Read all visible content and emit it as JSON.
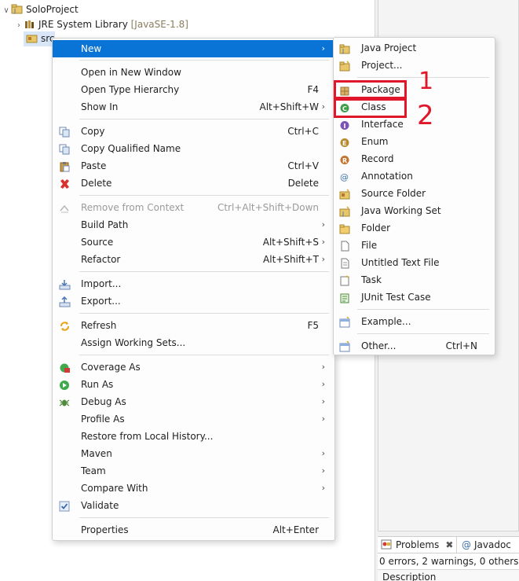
{
  "tree": {
    "project": "SoloProject",
    "jre_label": "JRE System Library",
    "jre_version": "[JavaSE-1.8]",
    "src": "src"
  },
  "context_menu": {
    "items": [
      {
        "label": "New",
        "accel": "",
        "submenu": true,
        "icon": "none",
        "highlighted": true
      },
      {
        "label": "Open in New Window",
        "accel": "",
        "icon": "none"
      },
      {
        "label": "Open Type Hierarchy",
        "accel": "F4",
        "icon": "none"
      },
      {
        "label": "Show In",
        "accel": "Alt+Shift+W",
        "submenu": true,
        "icon": "none"
      },
      {
        "label": "Copy",
        "accel": "Ctrl+C",
        "icon": "copy-icon"
      },
      {
        "label": "Copy Qualified Name",
        "accel": "",
        "icon": "copy-qualified-icon"
      },
      {
        "label": "Paste",
        "accel": "Ctrl+V",
        "icon": "paste-icon"
      },
      {
        "label": "Delete",
        "accel": "Delete",
        "icon": "delete-icon"
      },
      {
        "label": "Remove from Context",
        "accel": "Ctrl+Alt+Shift+Down",
        "icon": "remove-context-icon",
        "disabled": true
      },
      {
        "label": "Build Path",
        "accel": "",
        "submenu": true,
        "icon": "none"
      },
      {
        "label": "Source",
        "accel": "Alt+Shift+S",
        "submenu": true,
        "icon": "none"
      },
      {
        "label": "Refactor",
        "accel": "Alt+Shift+T",
        "submenu": true,
        "icon": "none"
      },
      {
        "label": "Import...",
        "accel": "",
        "icon": "import-icon"
      },
      {
        "label": "Export...",
        "accel": "",
        "icon": "export-icon"
      },
      {
        "label": "Refresh",
        "accel": "F5",
        "icon": "refresh-icon"
      },
      {
        "label": "Assign Working Sets...",
        "accel": "",
        "icon": "none"
      },
      {
        "label": "Coverage As",
        "accel": "",
        "submenu": true,
        "icon": "coverage-icon"
      },
      {
        "label": "Run As",
        "accel": "",
        "submenu": true,
        "icon": "run-icon"
      },
      {
        "label": "Debug As",
        "accel": "",
        "submenu": true,
        "icon": "debug-icon"
      },
      {
        "label": "Profile As",
        "accel": "",
        "submenu": true,
        "icon": "none"
      },
      {
        "label": "Restore from Local History...",
        "accel": "",
        "icon": "none"
      },
      {
        "label": "Maven",
        "accel": "",
        "submenu": true,
        "icon": "none"
      },
      {
        "label": "Team",
        "accel": "",
        "submenu": true,
        "icon": "none"
      },
      {
        "label": "Compare With",
        "accel": "",
        "submenu": true,
        "icon": "none"
      },
      {
        "label": "Validate",
        "accel": "",
        "icon": "validate-check-icon"
      },
      {
        "label": "Properties",
        "accel": "Alt+Enter",
        "icon": "none"
      }
    ]
  },
  "new_submenu": {
    "items": [
      {
        "label": "Java Project",
        "accel": "",
        "icon": "java-project-icon"
      },
      {
        "label": "Project...",
        "accel": "",
        "icon": "project-icon"
      },
      {
        "label": "Package",
        "accel": "",
        "icon": "package-icon"
      },
      {
        "label": "Class",
        "accel": "",
        "icon": "class-icon"
      },
      {
        "label": "Interface",
        "accel": "",
        "icon": "interface-icon"
      },
      {
        "label": "Enum",
        "accel": "",
        "icon": "enum-icon"
      },
      {
        "label": "Record",
        "accel": "",
        "icon": "record-icon"
      },
      {
        "label": "Annotation",
        "accel": "",
        "icon": "annotation-icon"
      },
      {
        "label": "Source Folder",
        "accel": "",
        "icon": "source-folder-icon"
      },
      {
        "label": "Java Working Set",
        "accel": "",
        "icon": "working-set-icon"
      },
      {
        "label": "Folder",
        "accel": "",
        "icon": "folder-icon"
      },
      {
        "label": "File",
        "accel": "",
        "icon": "file-icon"
      },
      {
        "label": "Untitled Text File",
        "accel": "",
        "icon": "text-file-icon"
      },
      {
        "label": "Task",
        "accel": "",
        "icon": "task-icon"
      },
      {
        "label": "JUnit Test Case",
        "accel": "",
        "icon": "junit-icon"
      },
      {
        "label": "Example...",
        "accel": "",
        "icon": "example-icon"
      },
      {
        "label": "Other...",
        "accel": "Ctrl+N",
        "icon": "other-icon"
      }
    ]
  },
  "annotations": {
    "one": "1",
    "two": "2",
    "color": "#e0162b"
  },
  "views": {
    "problems_tab": "Problems",
    "javadoc_tab": "Javadoc",
    "status": "0 errors, 2 warnings, 0 others",
    "description_header": "Description"
  },
  "colors": {
    "highlight": "#0a74d6",
    "annotation": "#e0162b"
  }
}
